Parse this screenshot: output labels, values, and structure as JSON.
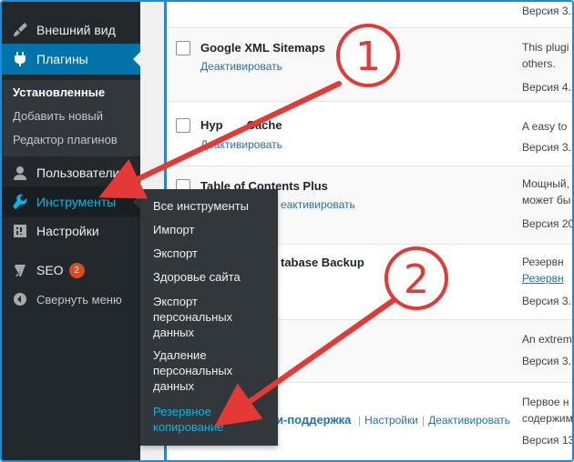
{
  "sidebar": {
    "items": [
      {
        "label": "Внешний вид",
        "icon": "paintbrush-icon"
      },
      {
        "label": "Плагины",
        "icon": "plugin-icon"
      },
      {
        "label": "Пользователи",
        "icon": "user-icon"
      },
      {
        "label": "Инструменты",
        "icon": "wrench-icon"
      },
      {
        "label": "Настройки",
        "icon": "settings-icon"
      },
      {
        "label": "SEO",
        "icon": "yoast-icon",
        "badge": "2"
      }
    ],
    "plugins_submenu": [
      "Установленные",
      "Добавить новый",
      "Редактор плагинов"
    ],
    "collapse_label": "Свернуть меню"
  },
  "tools_flyout": {
    "items": [
      "Все инструменты",
      "Импорт",
      "Экспорт",
      "Здоровье сайта",
      "Экспорт персональных данных",
      "Удаление персональных данных",
      "Резервное копирование"
    ],
    "lines": {
      "personal_export": [
        "Экспорт",
        "персональных",
        "данных"
      ],
      "personal_erase": [
        "Удаление",
        "персональных",
        "данных"
      ],
      "backup": [
        "Резервное",
        "копирование"
      ]
    }
  },
  "plugins": {
    "rows": [
      {
        "name": "",
        "action": "",
        "desc": [],
        "version": "Версия 3."
      },
      {
        "name": "Google XML Sitemaps",
        "action": "Деактивировать",
        "desc": [
          "This plugi",
          "others."
        ],
        "version": "Версия 4."
      },
      {
        "name": "Hyper Cache",
        "name_visible": "Hyp",
        "name_tail": "Cache",
        "action": "Деактивировать",
        "desc": [
          "A easy to"
        ],
        "version": "Версия 3."
      },
      {
        "name": "Table of Contents Plus",
        "action": "Деактивировать",
        "action_visible": "еактивировать",
        "desc": [
          "Мощный,",
          "может бы"
        ],
        "version": "Версия 20"
      },
      {
        "name": "Database Backup",
        "name_visible": "tabase Backup",
        "action": "",
        "desc": [
          "Резервн",
          "Резервн"
        ],
        "version": "Версия 3."
      },
      {
        "name": "",
        "action": "",
        "desc": [
          "An extrem"
        ],
        "version": "Версия 3."
      },
      {
        "name": "поддержка",
        "name_visible": "и-поддержка",
        "actions": [
          "Настройки",
          "Деактивировать"
        ],
        "desc": [
          "Первое н",
          "содержим"
        ],
        "version": "Версия 13"
      }
    ]
  },
  "annotations": {
    "callout_1": "1",
    "callout_2": "2",
    "color": "#e53935"
  },
  "colors": {
    "sidebar_bg": "#23282d",
    "active_bg": "#0073aa",
    "flyout_bg": "#32373c",
    "link": "#2271b1",
    "highlight": "#00b9eb",
    "badge": "#d54e21",
    "frame_border": "#1f8ad6"
  }
}
